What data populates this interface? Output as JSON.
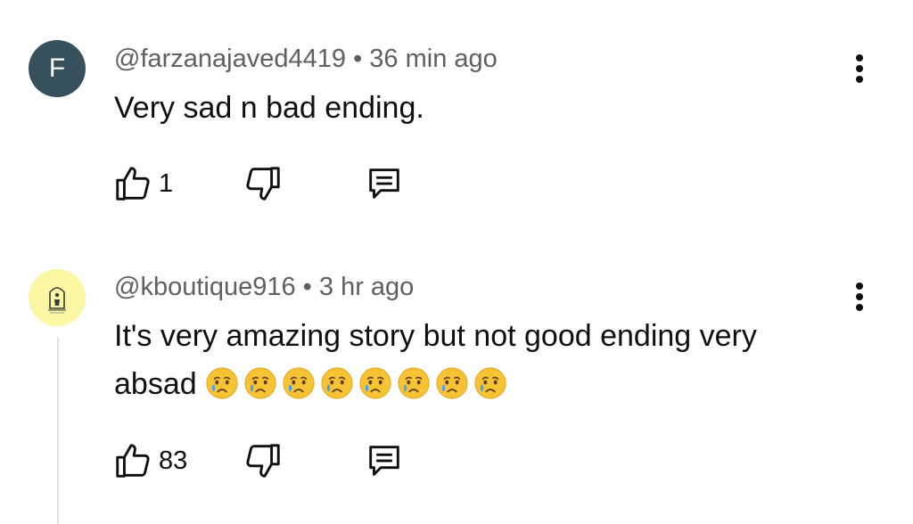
{
  "comments": [
    {
      "avatar_letter": "F",
      "handle": "@farzanajaved4419",
      "separator": "•",
      "time": "36 min ago",
      "text": "Very sad n bad ending.",
      "likes": "1",
      "has_replies_thread": false
    },
    {
      "avatar_letter": "",
      "handle": "@kboutique916",
      "separator": "•",
      "time": "3 hr ago",
      "text": "It's very amazing story but not good ending very absad",
      "emoji_name": "crying-face-emoji",
      "emoji_count": 8,
      "likes": "83",
      "has_replies_thread": true
    }
  ],
  "colors": {
    "avatar_f_bg": "#37515c",
    "avatar_k_bg": "#fbf7a3",
    "meta_text": "#606060",
    "body_text": "#0f0f0f"
  },
  "icons": [
    "thumbs-up-icon",
    "thumbs-down-icon",
    "reply-icon",
    "more-vertical-icon"
  ]
}
